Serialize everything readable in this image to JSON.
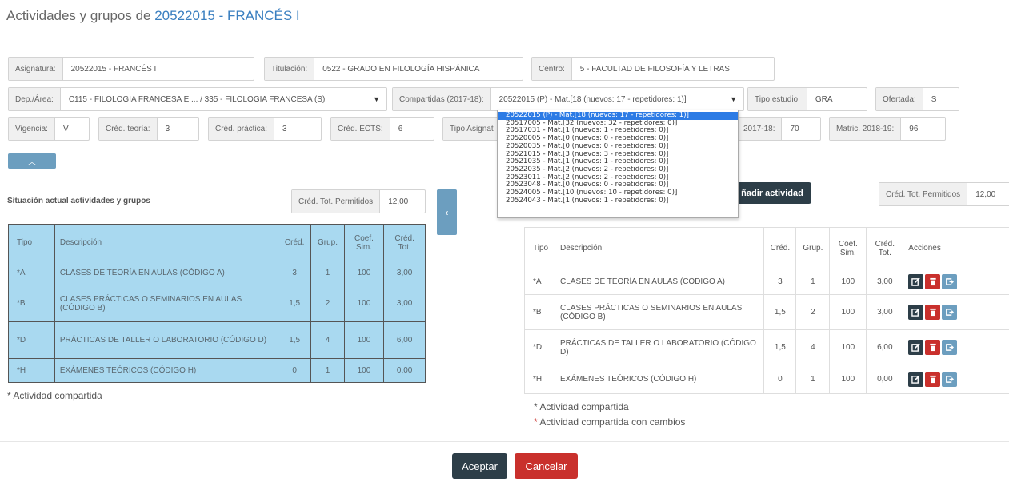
{
  "header": {
    "title_prefix": "Actividades y grupos de ",
    "title_link": "20522015 - FRANCÉS I"
  },
  "fields": {
    "asignatura": {
      "label": "Asignatura:",
      "value": "20522015 - FRANCÉS I"
    },
    "titulacion": {
      "label": "Titulación:",
      "value": "0522 - GRADO EN FILOLOGÍA HISPÁNICA"
    },
    "centro": {
      "label": "Centro:",
      "value": "5 - FACULTAD DE FILOSOFÍA Y LETRAS"
    },
    "dep_area": {
      "label": "Dep./Área:",
      "value": "C115 - FILOLOGIA FRANCESA E ... / 335 - FILOLOGIA FRANCESA (S)"
    },
    "compartidas": {
      "label": "Compartidas (2017-18):",
      "value": "20522015 (P) - Mat.[18 (nuevos: 17 - repetidores: 1)]"
    },
    "tipo_estudio": {
      "label": "Tipo estudio:",
      "value": "GRA"
    },
    "ofertada": {
      "label": "Ofertada:",
      "value": "S"
    },
    "vigencia": {
      "label": "Vigencia:",
      "value": "V"
    },
    "cred_teoria": {
      "label": "Créd. teoría:",
      "value": "3"
    },
    "cred_practica": {
      "label": "Créd. práctica:",
      "value": "3"
    },
    "cred_ects": {
      "label": "Créd. ECTS:",
      "value": "6"
    },
    "tipo_asignat": {
      "label": "Tipo Asignat"
    },
    "matric_2017": {
      "label": "2017-18:",
      "value": "70"
    },
    "matric_2018": {
      "label": "Matric. 2018-19:",
      "value": "96"
    }
  },
  "dropdown_options": [
    "20522015 (P) - Mat.[18 (nuevos: 17 - repetidores: 1)]",
    "20517005 - Mat.[32 (nuevos: 32 - repetidores: 0)]",
    "20517031 - Mat.[1 (nuevos: 1 - repetidores: 0)]",
    "20520005 - Mat.[0 (nuevos: 0 - repetidores: 0)]",
    "20520035 - Mat.[0 (nuevos: 0 - repetidores: 0)]",
    "20521015 - Mat.[3 (nuevos: 3 - repetidores: 0)]",
    "20521035 - Mat.[1 (nuevos: 1 - repetidores: 0)]",
    "20522035 - Mat.[2 (nuevos: 2 - repetidores: 0)]",
    "20523011 - Mat.[2 (nuevos: 2 - repetidores: 0)]",
    "20523048 - Mat.[0 (nuevos: 0 - repetidores: 0)]",
    "20524005 - Mat.[10 (nuevos: 10 - repetidores: 0)]",
    "20524043 - Mat.[1 (nuevos: 1 - repetidores: 0)]"
  ],
  "left_panel": {
    "title": "Situación actual actividades y grupos",
    "cred_label": "Créd. Tot. Permitidos",
    "cred_value": "12,00",
    "columns": [
      "Tipo",
      "Descripción",
      "Créd.",
      "Grup.",
      "Coef. Sim.",
      "Créd. Tot."
    ],
    "rows": [
      [
        "*A",
        "CLASES DE TEORÍA EN AULAS (CÓDIGO A)",
        "3",
        "1",
        "100",
        "3,00"
      ],
      [
        "*B",
        "CLASES PRÁCTICAS O SEMINARIOS EN AULAS (CÓDIGO B)",
        "1,5",
        "2",
        "100",
        "3,00"
      ],
      [
        "*D",
        "PRÁCTICAS DE TALLER O LABORATORIO (CÓDIGO D)",
        "1,5",
        "4",
        "100",
        "6,00"
      ],
      [
        "*H",
        "EXÁMENES TEÓRICOS (CÓDIGO H)",
        "0",
        "1",
        "100",
        "0,00"
      ]
    ],
    "note": "* Actividad compartida"
  },
  "right_panel": {
    "add_button": "ñadir actividad",
    "cred_label": "Créd. Tot. Permitidos",
    "cred_value": "12,00",
    "columns": [
      "Tipo",
      "Descripción",
      "Créd.",
      "Grup.",
      "Coef. Sim.",
      "Créd. Tot.",
      "Acciones"
    ],
    "rows": [
      [
        "*A",
        "CLASES DE TEORÍA EN AULAS (CÓDIGO A)",
        "3",
        "1",
        "100",
        "3,00"
      ],
      [
        "*B",
        "CLASES PRÁCTICAS O SEMINARIOS EN AULAS (CÓDIGO B)",
        "1,5",
        "2",
        "100",
        "3,00"
      ],
      [
        "*D",
        "PRÁCTICAS DE TALLER O LABORATORIO (CÓDIGO D)",
        "1,5",
        "4",
        "100",
        "6,00"
      ],
      [
        "*H",
        "EXÁMENES TEÓRICOS (CÓDIGO H)",
        "0",
        "1",
        "100",
        "0,00"
      ]
    ],
    "note1": "Actividad compartida",
    "note2": "Actividad compartida con cambios"
  },
  "footer": {
    "accept": "Aceptar",
    "cancel": "Cancelar"
  },
  "colors": {
    "accent_dark": "#2d3e48",
    "danger": "#c9302c",
    "info": "#6c9ebf",
    "highlight": "#a9d9f0"
  }
}
